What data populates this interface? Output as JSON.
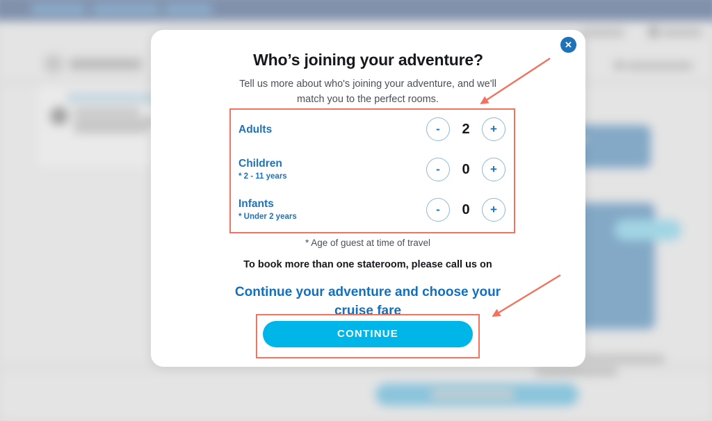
{
  "modal": {
    "title": "Who’s joining your adventure?",
    "subtitle": "Tell us more about who's joining your adventure, and we'll match you to the perfect rooms.",
    "close_label": "✕",
    "close_icon": "close-icon",
    "counters": [
      {
        "name": "Adults",
        "note": "",
        "value": "2",
        "decrement_label": "-",
        "increment_label": "+"
      },
      {
        "name": "Children",
        "note": "* 2 - 11 years",
        "value": "0",
        "decrement_label": "-",
        "increment_label": "+"
      },
      {
        "name": "Infants",
        "note": "* Under 2 years",
        "value": "0",
        "decrement_label": "-",
        "increment_label": "+"
      }
    ],
    "footnote": "* Age of guest at time of travel",
    "call_note": "To book more than one stateroom, please call us on",
    "fare_heading": "Continue your adventure and choose your cruise fare",
    "continue_label": "CONTINUE"
  },
  "colors": {
    "accent_blue": "#1e72b8",
    "cyan_button": "#00b5e8",
    "heading_blue": "#1270be",
    "annotation_red": "#f4715e",
    "topbar_navy": "#173a75"
  },
  "annotations": {
    "box_counters": "highlight-counters",
    "box_continue": "highlight-continue-button",
    "arrow_counters": "arrow-pointing-to-counters",
    "arrow_continue": "arrow-pointing-to-continue-button"
  }
}
